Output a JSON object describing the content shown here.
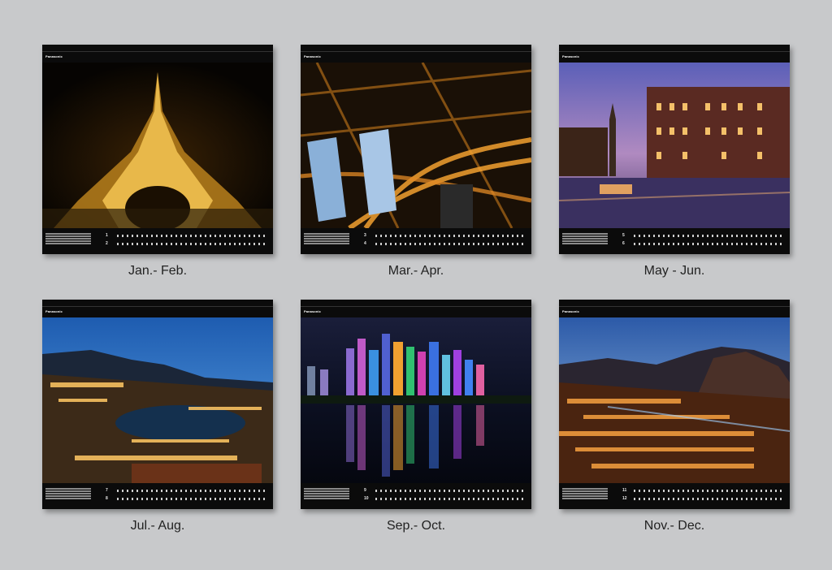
{
  "calendar_pages": [
    {
      "caption": "Jan.- Feb.",
      "brand": "Panasonic",
      "months": [
        "1",
        "2"
      ],
      "scene": "eiffel-tower-night"
    },
    {
      "caption": "Mar.- Apr.",
      "brand": "Panasonic",
      "months": [
        "3",
        "4"
      ],
      "scene": "city-towers-highway-night"
    },
    {
      "caption": "May - Jun.",
      "brand": "Panasonic",
      "months": [
        "5",
        "6"
      ],
      "scene": "canal-town-dusk"
    },
    {
      "caption": "Jul.- Aug.",
      "brand": "Panasonic",
      "months": [
        "7",
        "8"
      ],
      "scene": "harbor-city-twilight"
    },
    {
      "caption": "Sep.- Oct.",
      "brand": "Panasonic",
      "months": [
        "9",
        "10"
      ],
      "scene": "skyline-reflection-night"
    },
    {
      "caption": "Nov.- Dec.",
      "brand": "Panasonic",
      "months": [
        "11",
        "12"
      ],
      "scene": "mountain-town-lights"
    }
  ]
}
